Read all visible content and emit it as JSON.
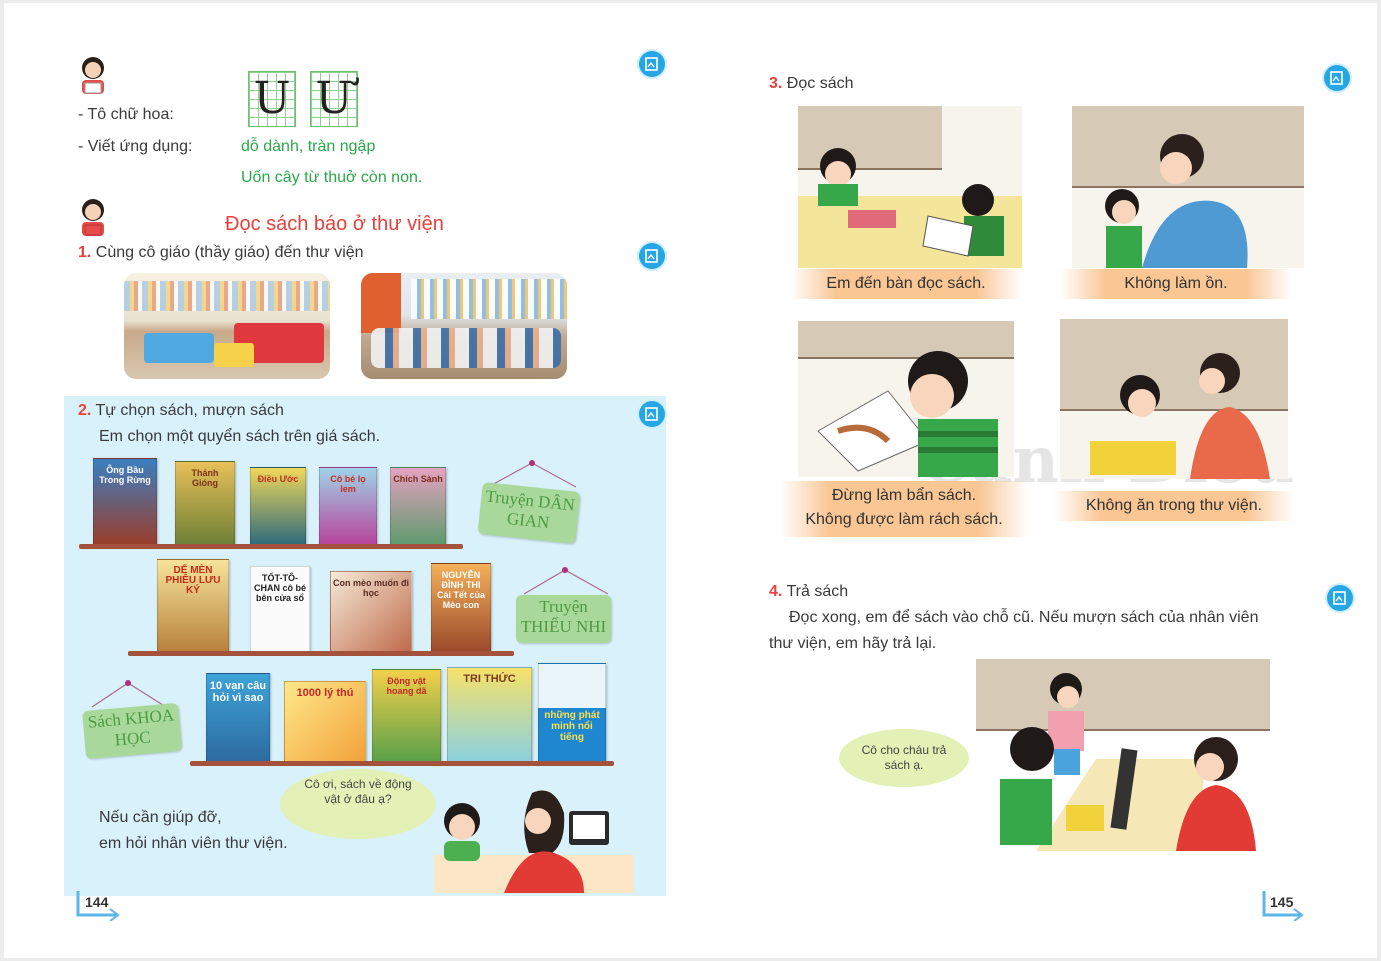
{
  "left_page": {
    "writing": {
      "to_chu_hoa_label": "- Tô chữ hoa:",
      "viet_ung_dung_label": "- Viết ứng dụng:",
      "letters": [
        "U",
        "Ư"
      ],
      "word_line": "dỗ dành, tràn ngập",
      "sentence_line": "Uốn cây từ thuở còn non."
    },
    "title": "Đọc sách báo ở thư viện",
    "section1": {
      "number": "1.",
      "text": "Cùng cô giáo (thầy giáo) đến thư viện"
    },
    "section2": {
      "number": "2.",
      "title": "Tự chọn sách, mượn sách",
      "subtitle": "Em chọn một quyển sách trên giá sách.",
      "books_row1": [
        "Ông Bầu Trong Rừng",
        "Thánh Gióng",
        "Điều Ước",
        "Cô bé lọ lem",
        "Chích Sành"
      ],
      "books_row2": [
        "DẾ MÈN PHIÊU LƯU KÝ",
        "TỐT-TÔ-CHAN cô bé bên cửa sổ",
        "Con mèo muốn đi học",
        "NGUYỄN ĐÌNH THI Cái Tết của Mèo con"
      ],
      "books_row3": [
        "10 vạn câu hỏi vì sao",
        "1000 lý thú",
        "Động vật hoang dã",
        "TRI THỨC",
        "những phát minh nổi tiếng"
      ],
      "tags": {
        "dan_gian": "Truyện DÂN GIAN",
        "thieu_nhi": "Truyện THIẾU NHI",
        "khoa_hoc": "Sách KHOA HỌC"
      },
      "help_text_1": "Nếu cần giúp đỡ,",
      "help_text_2": "em hỏi nhân viên thư viện.",
      "bubble_text": "Cô ơi, sách về động vật ở đâu ạ?"
    },
    "page_number": "144"
  },
  "right_page": {
    "section3": {
      "number": "3.",
      "title": "Đọc sách",
      "captions": [
        "Em đến bàn đọc sách.",
        "Không làm ồn.",
        "Đừng làm bẩn sách.",
        "Không được làm rách sách.",
        "Không ăn trong thư viện."
      ]
    },
    "section4": {
      "number": "4.",
      "title": "Trả sách",
      "line1": "Đọc xong, em để sách vào chỗ cũ. Nếu mượn sách của nhân viên",
      "line2": "thư viện, em hãy trả lại.",
      "bubble_text": "Cô cho cháu trả sách ạ."
    },
    "watermark": "Cánh Diều",
    "page_number": "145"
  },
  "colors": {
    "accent_red": "#e8413c",
    "accent_green": "#2aa84a",
    "icon_blue": "#27a6e6",
    "panel_blue": "#d9f1fb",
    "caption_orange": "#f9c694"
  },
  "icons": [
    "girl-reading-icon",
    "document-icon",
    "page-corner-icon"
  ]
}
